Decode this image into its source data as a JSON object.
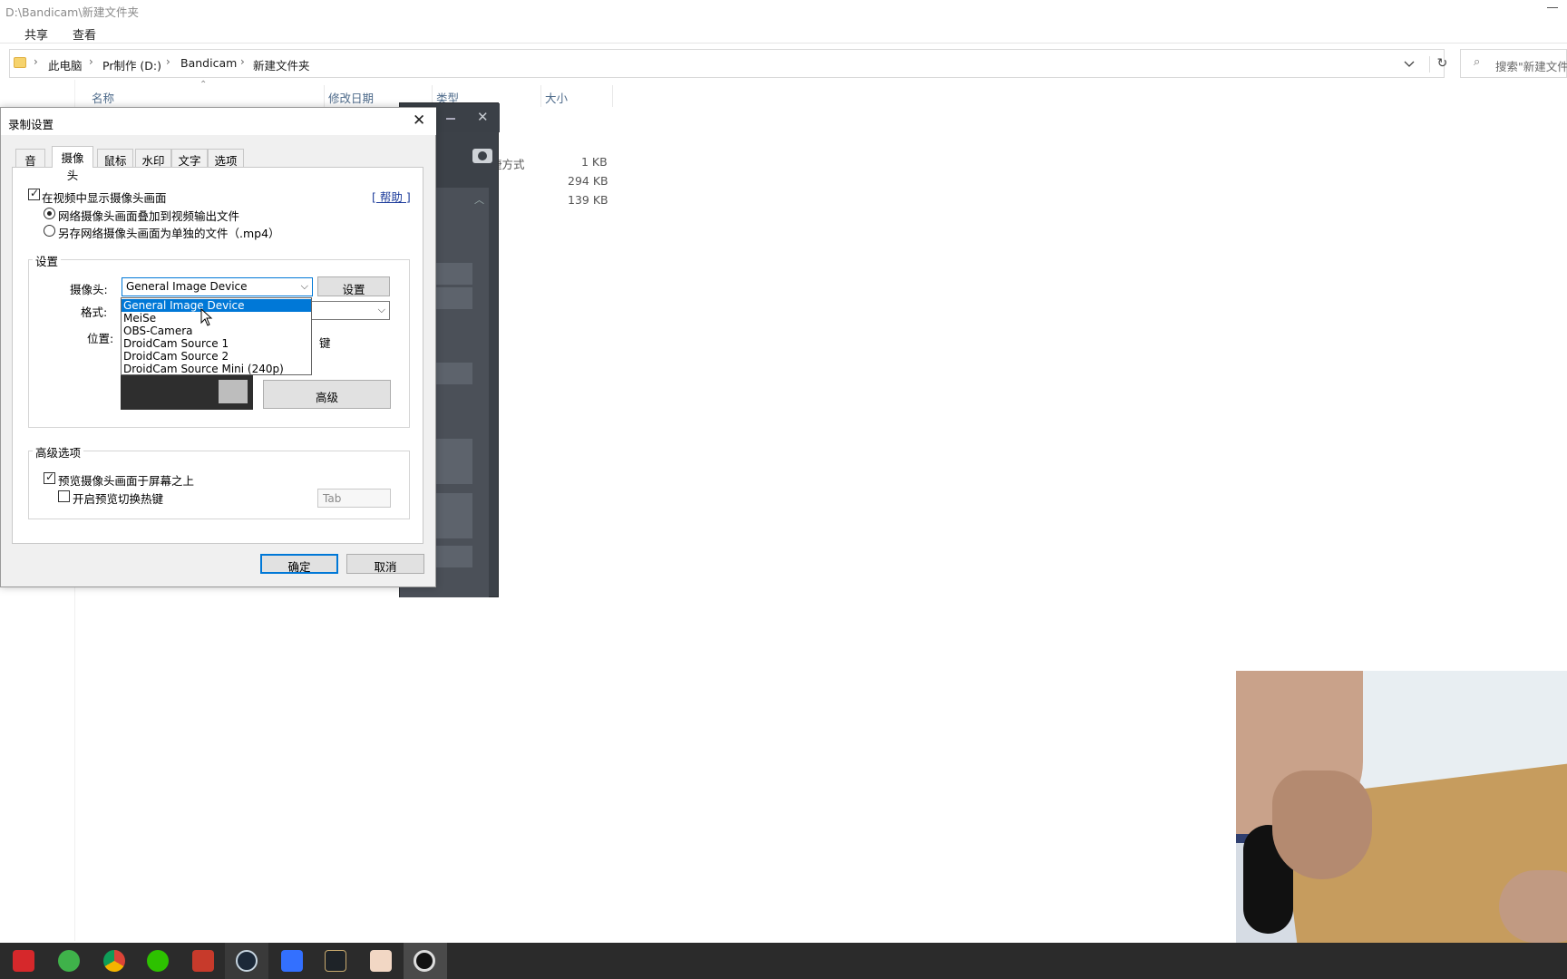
{
  "explorer": {
    "window_title": "D:\\Bandicam\\新建文件夹",
    "menu": [
      "共享",
      "查看"
    ],
    "breadcrumb": [
      "此电脑",
      "Pr制作 (D:)",
      "Bandicam",
      "新建文件夹"
    ],
    "search_placeholder": "搜索\"新建文件",
    "columns": {
      "name": "名称",
      "date": "修改日期",
      "type": "类型",
      "size": "大小"
    },
    "files": [
      {
        "type": "捷方式",
        "size": "1 KB"
      },
      {
        "type": "",
        "size": "294 KB"
      },
      {
        "type": "",
        "size": "139 KB"
      }
    ]
  },
  "dialog": {
    "title": "录制设置",
    "tabs": [
      "音频",
      "摄像头",
      "鼠标",
      "水印",
      "文字",
      "选项"
    ],
    "active_tab": "摄像头",
    "show_webcam_label": "在视频中显示摄像头画面",
    "help_link": "[ 帮助 ]",
    "overlay_radio": "网络摄像头画面叠加到视频输出文件",
    "separate_radio": "另存网络摄像头画面为单独的文件（.mp4）",
    "settings_group": "设置",
    "camera_label": "摄像头:",
    "camera_value": "General Image Device",
    "settings_button": "设置",
    "format_label": "格式:",
    "position_label": "位置:",
    "hotkey_partial": "键",
    "advanced_button": "高级",
    "camera_options": [
      "General Image Device",
      "MeiSe",
      "OBS-Camera",
      "DroidCam Source 1",
      "DroidCam Source 2",
      "DroidCam Source Mini (240p)"
    ],
    "advanced_group": "高级选项",
    "preview_on_top_label": "预览摄像头画面于屏幕之上",
    "toggle_hotkey_label": "开启预览切换热键",
    "hotkey_value": "Tab",
    "ok_button": "确定",
    "cancel_button": "取消"
  },
  "bandicam": {
    "partial_label": "捷方式"
  },
  "taskbar": {
    "apps": [
      "youdao-icon",
      "360-browser-icon",
      "chrome-icon",
      "wechat-icon",
      "app-red-icon",
      "steam-icon",
      "feishu-icon",
      "league-icon",
      "anime-app-icon",
      "bandicam-icon"
    ]
  },
  "colors": {
    "accent": "#0078d7",
    "bandicam_dark": "#3c4148",
    "record_red": "#d93a38",
    "taskbar": "#2b2b2b"
  }
}
